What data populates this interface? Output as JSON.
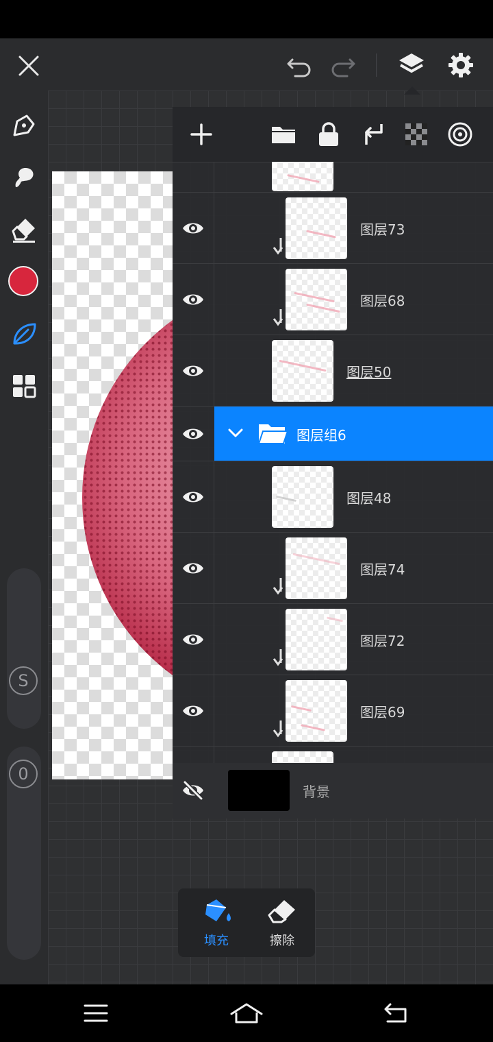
{
  "layers_panel": {
    "rows": [
      {
        "label": "图层73",
        "clipped": true
      },
      {
        "label": "图层68",
        "clipped": true
      },
      {
        "label": "图层50",
        "clipped": false
      },
      {
        "label": "图层组6",
        "group": true
      },
      {
        "label": "图层48",
        "clipped": false
      },
      {
        "label": "图层74",
        "clipped": true
      },
      {
        "label": "图层72",
        "clipped": true
      },
      {
        "label": "图层69",
        "clipped": true
      }
    ],
    "background_label": "背景"
  },
  "bottom_tools": {
    "fill_label": "填充",
    "erase_label": "擦除"
  },
  "sidebar": {
    "size_button_label": "S",
    "opacity_button_label": "0",
    "current_color": "#d7263d"
  },
  "colors": {
    "accent": "#0b84ff",
    "active_tool": "#2b8fff"
  },
  "icons": [
    "close-icon",
    "undo-icon",
    "redo-icon",
    "layers-icon",
    "gear-icon",
    "pen-icon",
    "smudge-icon",
    "eraser-icon",
    "color-icon",
    "leaf-icon",
    "grid-icon",
    "add-icon",
    "folder-icon",
    "lock-icon",
    "clip-icon",
    "transparency-icon",
    "target-icon",
    "eye-icon",
    "eye-off-icon",
    "chevron-down-icon",
    "paint-bucket-icon",
    "menu-icon",
    "home-icon",
    "back-icon"
  ]
}
